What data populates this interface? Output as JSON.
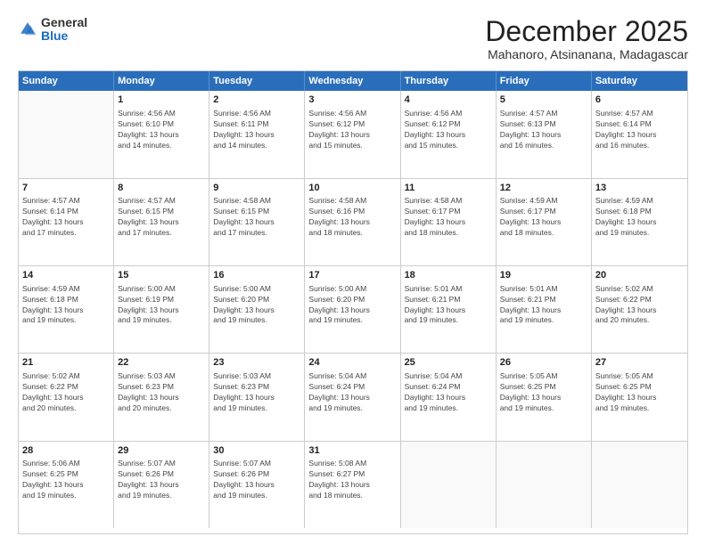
{
  "logo": {
    "general": "General",
    "blue": "Blue"
  },
  "title": "December 2025",
  "location": "Mahanoro, Atsinanana, Madagascar",
  "days": [
    "Sunday",
    "Monday",
    "Tuesday",
    "Wednesday",
    "Thursday",
    "Friday",
    "Saturday"
  ],
  "weeks": [
    [
      {
        "day": "",
        "info": ""
      },
      {
        "day": "1",
        "info": "Sunrise: 4:56 AM\nSunset: 6:10 PM\nDaylight: 13 hours\nand 14 minutes."
      },
      {
        "day": "2",
        "info": "Sunrise: 4:56 AM\nSunset: 6:11 PM\nDaylight: 13 hours\nand 14 minutes."
      },
      {
        "day": "3",
        "info": "Sunrise: 4:56 AM\nSunset: 6:12 PM\nDaylight: 13 hours\nand 15 minutes."
      },
      {
        "day": "4",
        "info": "Sunrise: 4:56 AM\nSunset: 6:12 PM\nDaylight: 13 hours\nand 15 minutes."
      },
      {
        "day": "5",
        "info": "Sunrise: 4:57 AM\nSunset: 6:13 PM\nDaylight: 13 hours\nand 16 minutes."
      },
      {
        "day": "6",
        "info": "Sunrise: 4:57 AM\nSunset: 6:14 PM\nDaylight: 13 hours\nand 16 minutes."
      }
    ],
    [
      {
        "day": "7",
        "info": "Sunrise: 4:57 AM\nSunset: 6:14 PM\nDaylight: 13 hours\nand 17 minutes."
      },
      {
        "day": "8",
        "info": "Sunrise: 4:57 AM\nSunset: 6:15 PM\nDaylight: 13 hours\nand 17 minutes."
      },
      {
        "day": "9",
        "info": "Sunrise: 4:58 AM\nSunset: 6:15 PM\nDaylight: 13 hours\nand 17 minutes."
      },
      {
        "day": "10",
        "info": "Sunrise: 4:58 AM\nSunset: 6:16 PM\nDaylight: 13 hours\nand 18 minutes."
      },
      {
        "day": "11",
        "info": "Sunrise: 4:58 AM\nSunset: 6:17 PM\nDaylight: 13 hours\nand 18 minutes."
      },
      {
        "day": "12",
        "info": "Sunrise: 4:59 AM\nSunset: 6:17 PM\nDaylight: 13 hours\nand 18 minutes."
      },
      {
        "day": "13",
        "info": "Sunrise: 4:59 AM\nSunset: 6:18 PM\nDaylight: 13 hours\nand 19 minutes."
      }
    ],
    [
      {
        "day": "14",
        "info": "Sunrise: 4:59 AM\nSunset: 6:18 PM\nDaylight: 13 hours\nand 19 minutes."
      },
      {
        "day": "15",
        "info": "Sunrise: 5:00 AM\nSunset: 6:19 PM\nDaylight: 13 hours\nand 19 minutes."
      },
      {
        "day": "16",
        "info": "Sunrise: 5:00 AM\nSunset: 6:20 PM\nDaylight: 13 hours\nand 19 minutes."
      },
      {
        "day": "17",
        "info": "Sunrise: 5:00 AM\nSunset: 6:20 PM\nDaylight: 13 hours\nand 19 minutes."
      },
      {
        "day": "18",
        "info": "Sunrise: 5:01 AM\nSunset: 6:21 PM\nDaylight: 13 hours\nand 19 minutes."
      },
      {
        "day": "19",
        "info": "Sunrise: 5:01 AM\nSunset: 6:21 PM\nDaylight: 13 hours\nand 19 minutes."
      },
      {
        "day": "20",
        "info": "Sunrise: 5:02 AM\nSunset: 6:22 PM\nDaylight: 13 hours\nand 20 minutes."
      }
    ],
    [
      {
        "day": "21",
        "info": "Sunrise: 5:02 AM\nSunset: 6:22 PM\nDaylight: 13 hours\nand 20 minutes."
      },
      {
        "day": "22",
        "info": "Sunrise: 5:03 AM\nSunset: 6:23 PM\nDaylight: 13 hours\nand 20 minutes."
      },
      {
        "day": "23",
        "info": "Sunrise: 5:03 AM\nSunset: 6:23 PM\nDaylight: 13 hours\nand 19 minutes."
      },
      {
        "day": "24",
        "info": "Sunrise: 5:04 AM\nSunset: 6:24 PM\nDaylight: 13 hours\nand 19 minutes."
      },
      {
        "day": "25",
        "info": "Sunrise: 5:04 AM\nSunset: 6:24 PM\nDaylight: 13 hours\nand 19 minutes."
      },
      {
        "day": "26",
        "info": "Sunrise: 5:05 AM\nSunset: 6:25 PM\nDaylight: 13 hours\nand 19 minutes."
      },
      {
        "day": "27",
        "info": "Sunrise: 5:05 AM\nSunset: 6:25 PM\nDaylight: 13 hours\nand 19 minutes."
      }
    ],
    [
      {
        "day": "28",
        "info": "Sunrise: 5:06 AM\nSunset: 6:25 PM\nDaylight: 13 hours\nand 19 minutes."
      },
      {
        "day": "29",
        "info": "Sunrise: 5:07 AM\nSunset: 6:26 PM\nDaylight: 13 hours\nand 19 minutes."
      },
      {
        "day": "30",
        "info": "Sunrise: 5:07 AM\nSunset: 6:26 PM\nDaylight: 13 hours\nand 19 minutes."
      },
      {
        "day": "31",
        "info": "Sunrise: 5:08 AM\nSunset: 6:27 PM\nDaylight: 13 hours\nand 18 minutes."
      },
      {
        "day": "",
        "info": ""
      },
      {
        "day": "",
        "info": ""
      },
      {
        "day": "",
        "info": ""
      }
    ]
  ]
}
